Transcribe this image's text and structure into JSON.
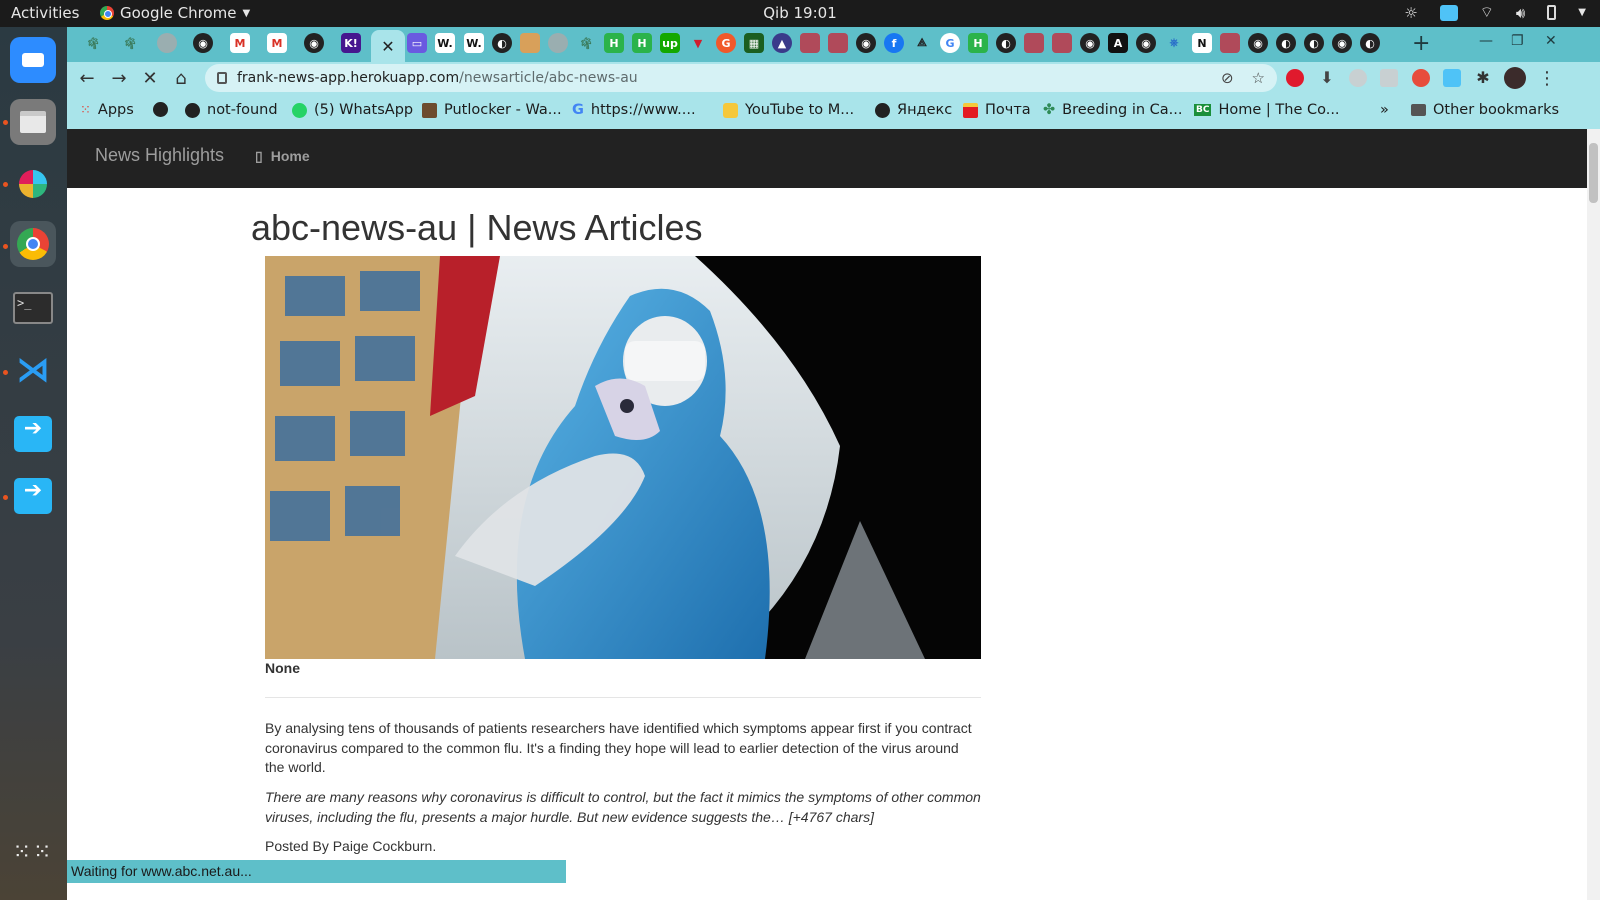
{
  "system_bar": {
    "activities": "Activities",
    "app_name": "Google Chrome",
    "clock": "Qib 19:01"
  },
  "dock": {
    "items": [
      "Zoom",
      "Files",
      "Slack",
      "Google Chrome",
      "Terminal",
      "Visual Studio Code",
      "Remote App",
      "Remote App"
    ]
  },
  "browser": {
    "url_host": "frank-news-app.herokuapp.com",
    "url_path": "/newsarticle/abc-news-au",
    "status": "Waiting for www.abc.net.au...",
    "bookmarks": [
      {
        "label": "Apps",
        "icon": "apps-grid-icon"
      },
      {
        "label": "",
        "icon": "globe-icon"
      },
      {
        "label": "not-found",
        "icon": "github-icon"
      },
      {
        "label": "(5) WhatsApp",
        "icon": "whatsapp-icon"
      },
      {
        "label": "Putlocker - Wa...",
        "icon": "film-icon"
      },
      {
        "label": "https://www....",
        "icon": "google-icon"
      },
      {
        "label": "YouTube to M...",
        "icon": "download-icon"
      },
      {
        "label": "Яндекс",
        "icon": "globe-icon"
      },
      {
        "label": "Почта",
        "icon": "mail-icon"
      },
      {
        "label": "Breeding in Ca...",
        "icon": "leaf-icon"
      },
      {
        "label": "Home | The Co...",
        "icon": "bc-icon"
      }
    ],
    "bookmarks_overflow": "»",
    "other_bookmarks": "Other bookmarks"
  },
  "page": {
    "brand": "News Highlights",
    "nav_home": "Home",
    "title": "abc-news-au | News Articles",
    "image_caption": "None",
    "description": "By analysing tens of thousands of patients researchers have identified which symptoms appear first if you contract coronavirus compared to the common flu. It's a finding they hope will lead to earlier detection of the virus around the world.",
    "content": "There are many reasons why coronavirus is difficult to control, but the fact it mimics the symptoms of other common viruses, including the flu, presents a major hurdle. But new evidence suggests the… [+4767 chars]",
    "author": "Posted By Paige Cockburn."
  }
}
